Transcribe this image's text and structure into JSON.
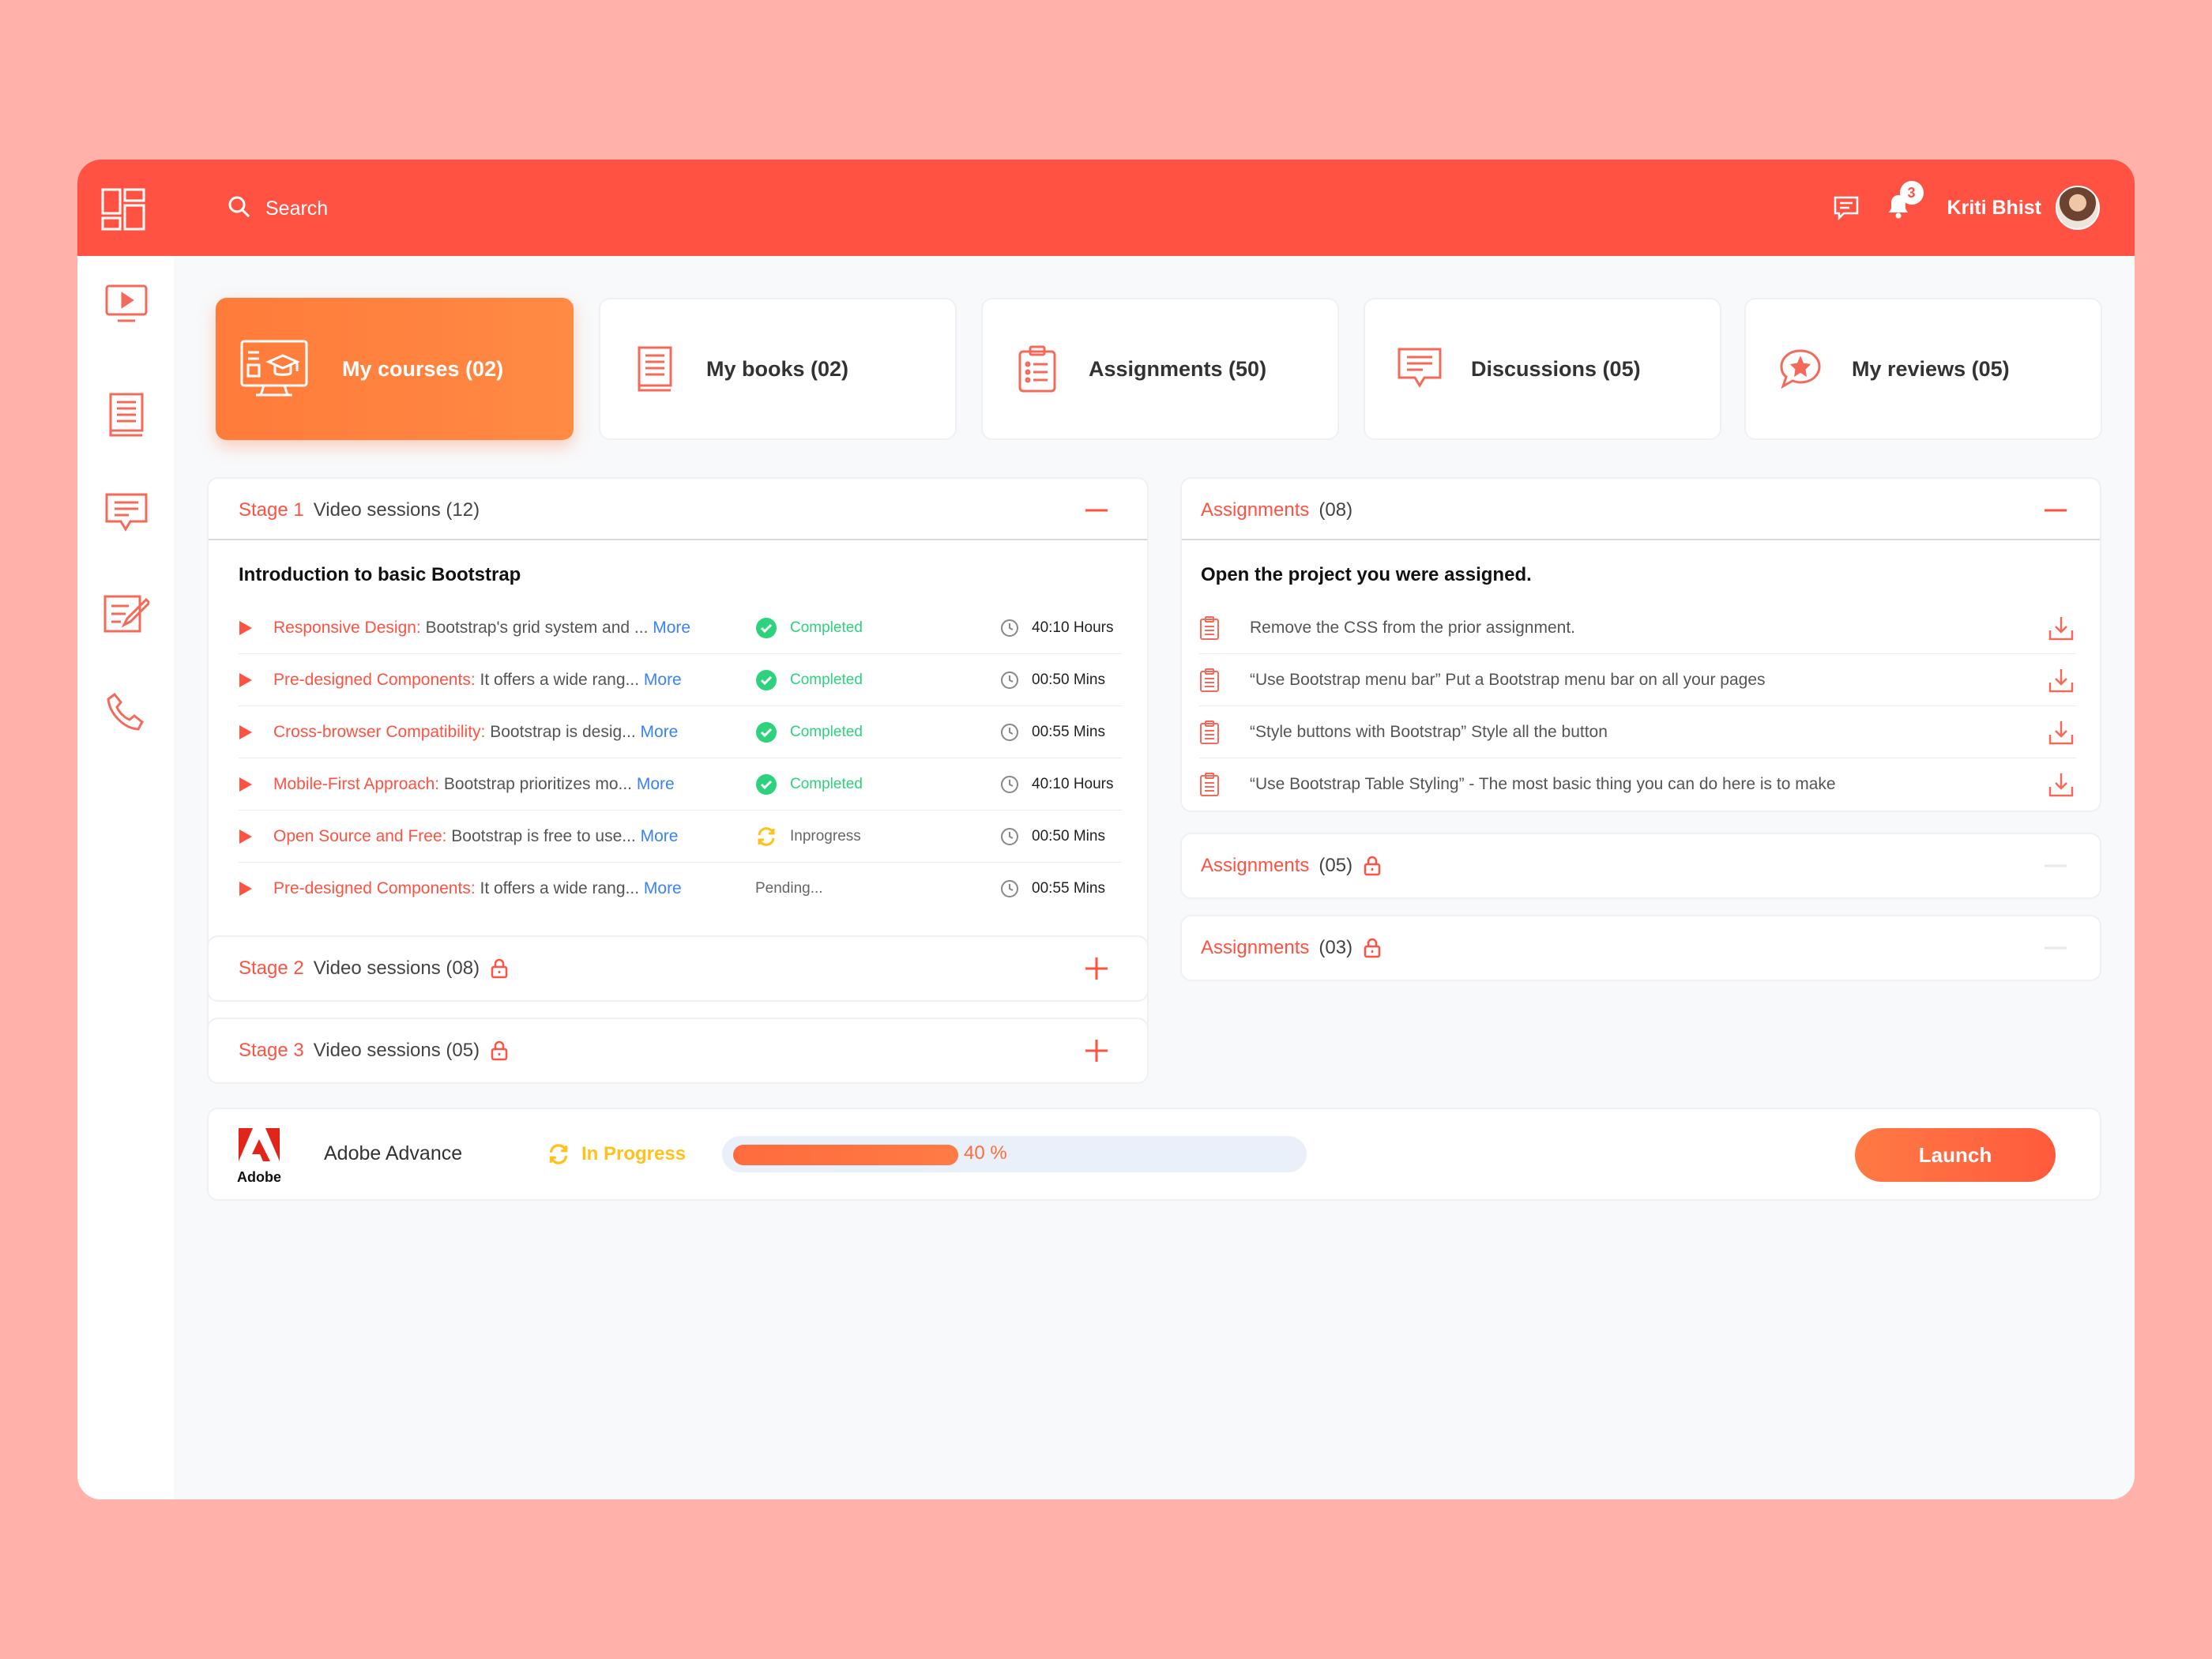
{
  "header": {
    "search_placeholder": "Search",
    "notification_count": "3",
    "user_name": "Kriti Bhist"
  },
  "sidebar": {
    "items": [
      "video-icon",
      "book-icon",
      "discussion-icon",
      "edit-icon",
      "phone-icon"
    ]
  },
  "cards": [
    {
      "label": "My courses (02)",
      "icon": "course-icon",
      "active": true
    },
    {
      "label": "My books (02)",
      "icon": "book-icon"
    },
    {
      "label": "Assignments (50)",
      "icon": "clipboard-icon"
    },
    {
      "label": "Discussions (05)",
      "icon": "discussion-icon"
    },
    {
      "label": "My reviews (05)",
      "icon": "review-icon"
    }
  ],
  "stages": [
    {
      "stage": "Stage 1",
      "title": "Video sessions (12)",
      "expanded": true,
      "section_title": "Introduction to basic Bootstrap",
      "sessions": [
        {
          "name": "Responsive Design:",
          "desc": " Bootstrap's grid system and ... ",
          "more": "More",
          "status": "Completed",
          "duration": "40:10 Hours"
        },
        {
          "name": "Pre-designed Components:",
          "desc": " It offers a wide rang... ",
          "more": "More",
          "status": "Completed",
          "duration": "00:50 Mins"
        },
        {
          "name": "Cross-browser Compatibility:",
          "desc": " Bootstrap is desig... ",
          "more": "More",
          "status": "Completed",
          "duration": "00:55 Mins"
        },
        {
          "name": "Mobile-First Approach:",
          "desc": " Bootstrap prioritizes mo... ",
          "more": "More",
          "status": "Completed",
          "duration": "40:10 Hours"
        },
        {
          "name": "Open Source and Free:",
          "desc": " Bootstrap is free to use... ",
          "more": "More",
          "status": "Inprogress",
          "duration": "00:50 Mins"
        },
        {
          "name": "Pre-designed Components:",
          "desc": " It offers a wide rang... ",
          "more": "More",
          "status": "Pending...",
          "duration": "00:55 Mins"
        }
      ]
    },
    {
      "stage": "Stage 2",
      "title": "Video sessions (08)",
      "locked": true
    },
    {
      "stage": "Stage 3",
      "title": "Video sessions (05)",
      "locked": true
    }
  ],
  "assignments": [
    {
      "label": "Assignments",
      "count": "(08)",
      "expanded": true,
      "section_title": "Open the project you were assigned.",
      "items": [
        "Remove the CSS from the prior assignment.",
        "“Use Bootstrap menu bar” Put a Bootstrap menu bar on all your pages",
        "“Style buttons with Bootstrap” Style all the button",
        "“Use Bootstrap Table Styling” - The most basic thing you can do here is to make"
      ]
    },
    {
      "label": "Assignments",
      "count": "(05)",
      "locked": true
    },
    {
      "label": "Assignments",
      "count": "(03)",
      "locked": true
    }
  ],
  "bottom": {
    "logo_text": "Adobe",
    "product": "Adobe Advance",
    "status": "In Progress",
    "progress_percent": 40,
    "progress_label": "40 %",
    "launch_label": "Launch"
  },
  "colors": {
    "brand": "#FF5242",
    "accent_orange": "#FF7B3A",
    "completed": "#2DD27C",
    "in_progress": "#FFC21A",
    "link": "#3B82F6"
  }
}
